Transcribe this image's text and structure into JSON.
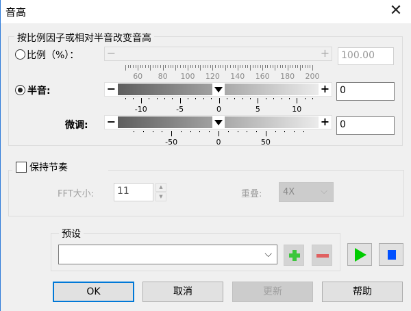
{
  "window": {
    "title": "音高",
    "close_icon": "close-icon"
  },
  "pitch_group": {
    "legend": "按比例因子或相对半音改变音高",
    "ratio": {
      "label": "比例（%）：",
      "selected": false,
      "minus": "−",
      "plus": "+",
      "value": "100.00",
      "scale_min": 50,
      "scale_max": 200,
      "tick_labels": [
        "60",
        "80",
        "100",
        "120",
        "140",
        "160",
        "180",
        "200"
      ],
      "tick_values": [
        60,
        80,
        100,
        120,
        140,
        160,
        180,
        200
      ]
    },
    "semitone": {
      "label": "半音:",
      "selected": true,
      "minus": "−",
      "plus": "+",
      "value": "0",
      "slider_value": 0,
      "scale_min": -12,
      "scale_max": 12,
      "tick_labels": [
        "-10",
        "-5",
        "0",
        "5",
        "10"
      ],
      "tick_values": [
        -10,
        -5,
        0,
        5,
        10
      ]
    },
    "finetune": {
      "label": "微调:",
      "minus": "−",
      "plus": "+",
      "value": "0",
      "slider_value": 0,
      "scale_min": -90,
      "scale_max": 90,
      "tick_labels": [
        "-50",
        "0",
        "50"
      ],
      "tick_values": [
        -50,
        0,
        50
      ]
    }
  },
  "tempo_group": {
    "checkbox_label": "保持节奏",
    "checked": false,
    "fft_label": "FFT大小:",
    "fft_value": "11",
    "overlap_label": "重叠:",
    "overlap_value": "4X"
  },
  "preset_group": {
    "legend": "预设",
    "value": ""
  },
  "buttons": {
    "ok": "OK",
    "cancel": "取消",
    "update": "更新",
    "help": "帮助"
  },
  "colors": {
    "accent": "#0078d7",
    "add": "#3cc63c",
    "remove": "#e06060",
    "play": "#00cc00",
    "stop": "#0050ff"
  }
}
